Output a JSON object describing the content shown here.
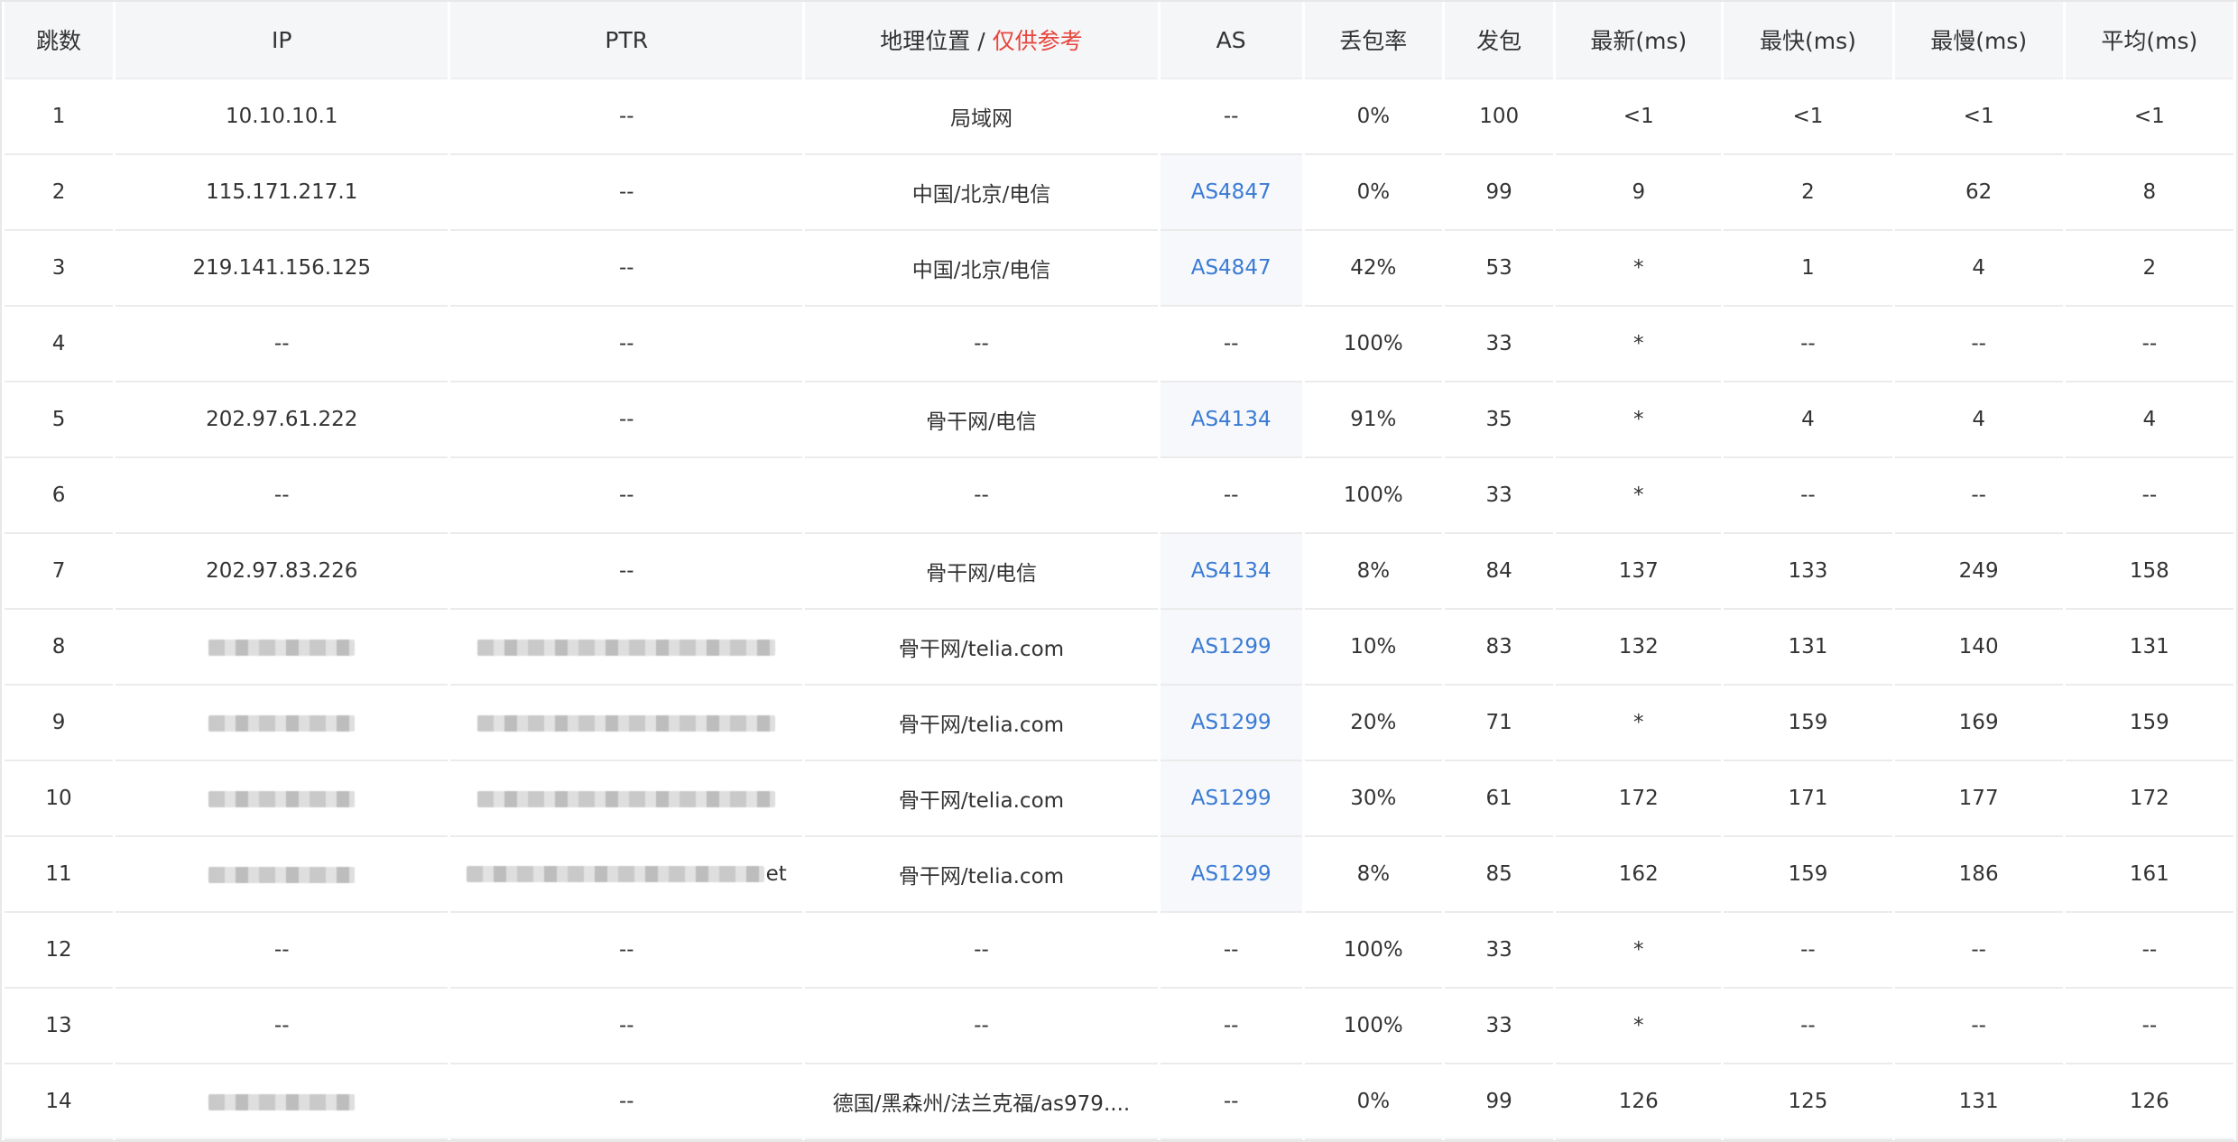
{
  "headers": {
    "hop": "跳数",
    "ip": "IP",
    "ptr": "PTR",
    "geo": "地理位置",
    "geo_sep": "/",
    "geo_note": "仅供参考",
    "as": "AS",
    "loss": "丢包率",
    "sent": "发包",
    "last": "最新(ms)",
    "best": "最快(ms)",
    "worst": "最慢(ms)",
    "avg": "平均(ms)"
  },
  "colors": {
    "as_link": "#3a7bd5",
    "note_red": "#e8453c",
    "header_bg": "#f5f6f8"
  },
  "rows": [
    {
      "hop": "1",
      "ip": "10.10.10.1",
      "ip_redacted": false,
      "ptr": "--",
      "ptr_redacted": false,
      "ptr_tail": "",
      "geo": "局域网",
      "as": "--",
      "as_link": false,
      "loss": "0%",
      "sent": "100",
      "last": "<1",
      "best": "<1",
      "worst": "<1",
      "avg": "<1"
    },
    {
      "hop": "2",
      "ip": "115.171.217.1",
      "ip_redacted": false,
      "ptr": "--",
      "ptr_redacted": false,
      "ptr_tail": "",
      "geo": "中国/北京/电信",
      "as": "AS4847",
      "as_link": true,
      "loss": "0%",
      "sent": "99",
      "last": "9",
      "best": "2",
      "worst": "62",
      "avg": "8"
    },
    {
      "hop": "3",
      "ip": "219.141.156.125",
      "ip_redacted": false,
      "ptr": "--",
      "ptr_redacted": false,
      "ptr_tail": "",
      "geo": "中国/北京/电信",
      "as": "AS4847",
      "as_link": true,
      "loss": "42%",
      "sent": "53",
      "last": "*",
      "best": "1",
      "worst": "4",
      "avg": "2"
    },
    {
      "hop": "4",
      "ip": "--",
      "ip_redacted": false,
      "ptr": "--",
      "ptr_redacted": false,
      "ptr_tail": "",
      "geo": "--",
      "as": "--",
      "as_link": false,
      "loss": "100%",
      "sent": "33",
      "last": "*",
      "best": "--",
      "worst": "--",
      "avg": "--"
    },
    {
      "hop": "5",
      "ip": "202.97.61.222",
      "ip_redacted": false,
      "ptr": "--",
      "ptr_redacted": false,
      "ptr_tail": "",
      "geo": "骨干网/电信",
      "as": "AS4134",
      "as_link": true,
      "loss": "91%",
      "sent": "35",
      "last": "*",
      "best": "4",
      "worst": "4",
      "avg": "4"
    },
    {
      "hop": "6",
      "ip": "--",
      "ip_redacted": false,
      "ptr": "--",
      "ptr_redacted": false,
      "ptr_tail": "",
      "geo": "--",
      "as": "--",
      "as_link": false,
      "loss": "100%",
      "sent": "33",
      "last": "*",
      "best": "--",
      "worst": "--",
      "avg": "--"
    },
    {
      "hop": "7",
      "ip": "202.97.83.226",
      "ip_redacted": false,
      "ptr": "--",
      "ptr_redacted": false,
      "ptr_tail": "",
      "geo": "骨干网/电信",
      "as": "AS4134",
      "as_link": true,
      "loss": "8%",
      "sent": "84",
      "last": "137",
      "best": "133",
      "worst": "249",
      "avg": "158"
    },
    {
      "hop": "8",
      "ip": "",
      "ip_redacted": true,
      "ptr": "",
      "ptr_redacted": true,
      "ptr_tail": "",
      "geo": "骨干网/telia.com",
      "as": "AS1299",
      "as_link": true,
      "loss": "10%",
      "sent": "83",
      "last": "132",
      "best": "131",
      "worst": "140",
      "avg": "131"
    },
    {
      "hop": "9",
      "ip": "",
      "ip_redacted": true,
      "ptr": "",
      "ptr_redacted": true,
      "ptr_tail": "",
      "geo": "骨干网/telia.com",
      "as": "AS1299",
      "as_link": true,
      "loss": "20%",
      "sent": "71",
      "last": "*",
      "best": "159",
      "worst": "169",
      "avg": "159"
    },
    {
      "hop": "10",
      "ip": "",
      "ip_redacted": true,
      "ptr": "",
      "ptr_redacted": true,
      "ptr_tail": "",
      "geo": "骨干网/telia.com",
      "as": "AS1299",
      "as_link": true,
      "loss": "30%",
      "sent": "61",
      "last": "172",
      "best": "171",
      "worst": "177",
      "avg": "172"
    },
    {
      "hop": "11",
      "ip": "",
      "ip_redacted": true,
      "ptr": "",
      "ptr_redacted": true,
      "ptr_tail": "et",
      "geo": "骨干网/telia.com",
      "as": "AS1299",
      "as_link": true,
      "loss": "8%",
      "sent": "85",
      "last": "162",
      "best": "159",
      "worst": "186",
      "avg": "161"
    },
    {
      "hop": "12",
      "ip": "--",
      "ip_redacted": false,
      "ptr": "--",
      "ptr_redacted": false,
      "ptr_tail": "",
      "geo": "--",
      "as": "--",
      "as_link": false,
      "loss": "100%",
      "sent": "33",
      "last": "*",
      "best": "--",
      "worst": "--",
      "avg": "--"
    },
    {
      "hop": "13",
      "ip": "--",
      "ip_redacted": false,
      "ptr": "--",
      "ptr_redacted": false,
      "ptr_tail": "",
      "geo": "--",
      "as": "--",
      "as_link": false,
      "loss": "100%",
      "sent": "33",
      "last": "*",
      "best": "--",
      "worst": "--",
      "avg": "--"
    },
    {
      "hop": "14",
      "ip": "",
      "ip_redacted": true,
      "ptr": "--",
      "ptr_redacted": false,
      "ptr_tail": "",
      "geo": "德国/黑森州/法兰克福/as979....",
      "as": "--",
      "as_link": false,
      "loss": "0%",
      "sent": "99",
      "last": "126",
      "best": "125",
      "worst": "131",
      "avg": "126"
    }
  ]
}
